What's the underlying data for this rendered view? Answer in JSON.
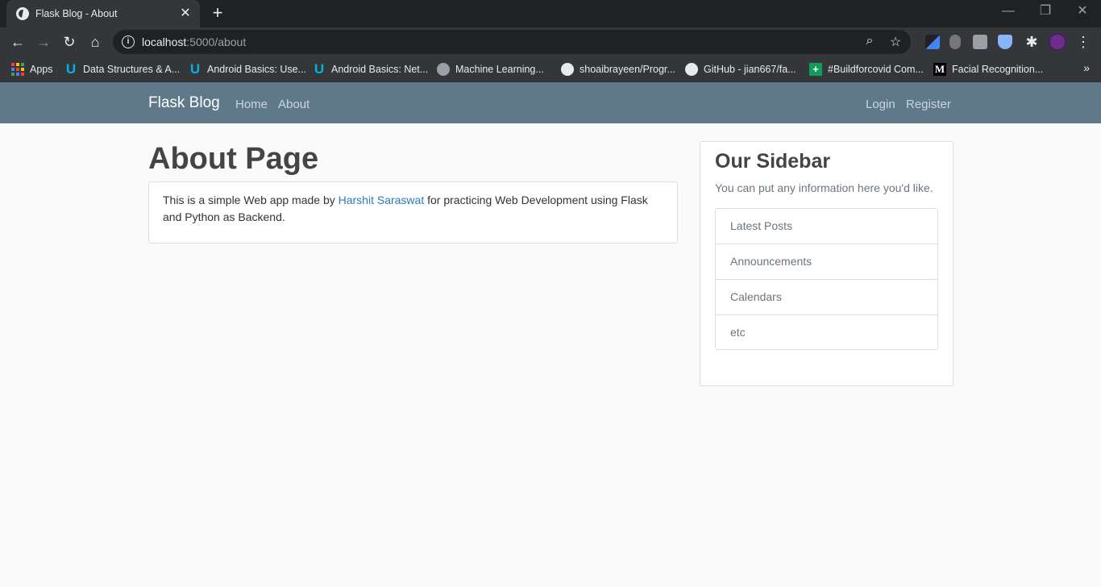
{
  "browser": {
    "tab_title": "Flask Blog - About",
    "url_host": "localhost",
    "url_path": ":5000/about",
    "bookmarks": [
      {
        "label": "Apps",
        "icon": "apps-grid-icon"
      },
      {
        "label": "Data Structures & A...",
        "icon": "udacity-icon"
      },
      {
        "label": "Android Basics: Use...",
        "icon": "udacity-icon"
      },
      {
        "label": "Android Basics: Net...",
        "icon": "udacity-icon"
      },
      {
        "label": "Machine Learning...",
        "icon": "brain-icon"
      },
      {
        "label": "shoaibrayeen/Progr...",
        "icon": "github-icon"
      },
      {
        "label": "GitHub - jian667/fa...",
        "icon": "github-icon"
      },
      {
        "label": "#Buildforcovid Com...",
        "icon": "buildforcovid-icon"
      },
      {
        "label": "Facial Recognition...",
        "icon": "medium-icon"
      }
    ]
  },
  "navbar": {
    "brand": "Flask Blog",
    "left_links": [
      "Home",
      "About"
    ],
    "right_links": [
      "Login",
      "Register"
    ],
    "color": "#5f788a"
  },
  "main": {
    "title": "About Page",
    "text_before": "This is a simple Web app made by ",
    "author_link": "Harshit Saraswat",
    "text_after": " for practicing Web Development using Flask and Python as Backend."
  },
  "sidebar": {
    "title": "Our Sidebar",
    "description": "You can put any information here you'd like.",
    "items": [
      "Latest Posts",
      "Announcements",
      "Calendars",
      "etc"
    ]
  }
}
